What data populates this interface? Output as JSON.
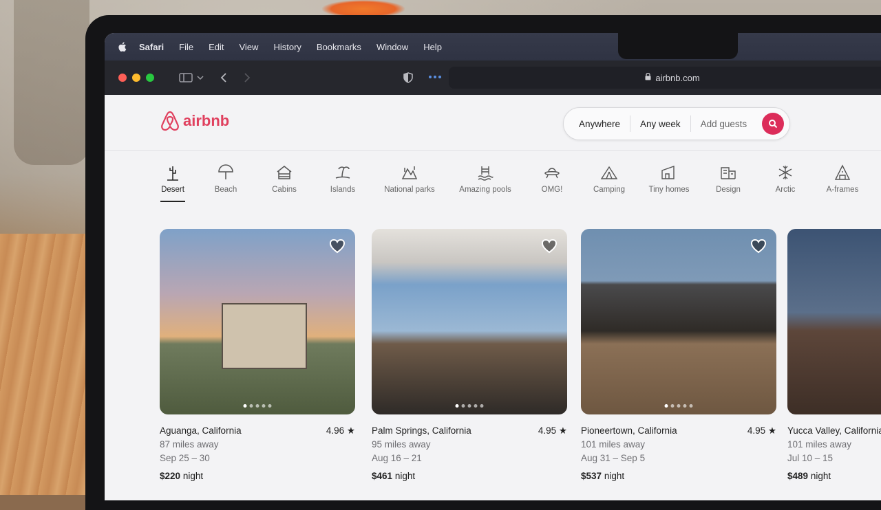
{
  "menubar": {
    "app": "Safari",
    "items": [
      "File",
      "Edit",
      "View",
      "History",
      "Bookmarks",
      "Window",
      "Help"
    ]
  },
  "toolbar": {
    "url": "airbnb.com"
  },
  "header": {
    "logo_text": "airbnb",
    "search": {
      "where": "Anywhere",
      "when": "Any week",
      "guests": "Add guests"
    }
  },
  "categories": [
    {
      "label": "Desert",
      "icon": "cactus-icon",
      "active": true
    },
    {
      "label": "Beach",
      "icon": "umbrella-icon"
    },
    {
      "label": "Cabins",
      "icon": "cabin-icon"
    },
    {
      "label": "Islands",
      "icon": "palm-tree-icon"
    },
    {
      "label": "National parks",
      "icon": "mountain-trees-icon"
    },
    {
      "label": "Amazing pools",
      "icon": "pool-icon"
    },
    {
      "label": "OMG!",
      "icon": "ufo-icon"
    },
    {
      "label": "Camping",
      "icon": "tent-icon"
    },
    {
      "label": "Tiny homes",
      "icon": "tiny-home-icon"
    },
    {
      "label": "Design",
      "icon": "design-building-icon"
    },
    {
      "label": "Arctic",
      "icon": "snowflake-icon"
    },
    {
      "label": "A-frames",
      "icon": "a-frame-icon"
    }
  ],
  "listings": [
    {
      "location": "Aguanga, California",
      "rating": "4.96 ★",
      "distance": "87 miles away",
      "dates": "Sep 25 – 30",
      "price": "$220",
      "price_unit": "night"
    },
    {
      "location": "Palm Springs, California",
      "rating": "4.95 ★",
      "distance": "95 miles away",
      "dates": "Aug 16 – 21",
      "price": "$461",
      "price_unit": "night"
    },
    {
      "location": "Pioneertown, California",
      "rating": "4.95 ★",
      "distance": "101 miles away",
      "dates": "Aug 31 – Sep 5",
      "price": "$537",
      "price_unit": "night"
    },
    {
      "location": "Yucca Valley, California",
      "rating": "",
      "distance": "101 miles away",
      "dates": "Jul 10 – 15",
      "price": "$489",
      "price_unit": "night"
    }
  ],
  "colors": {
    "brand": "#e0405e",
    "search_button": "#dc2d5a",
    "menubar": "#363a4a",
    "toolbar": "#26272d"
  }
}
